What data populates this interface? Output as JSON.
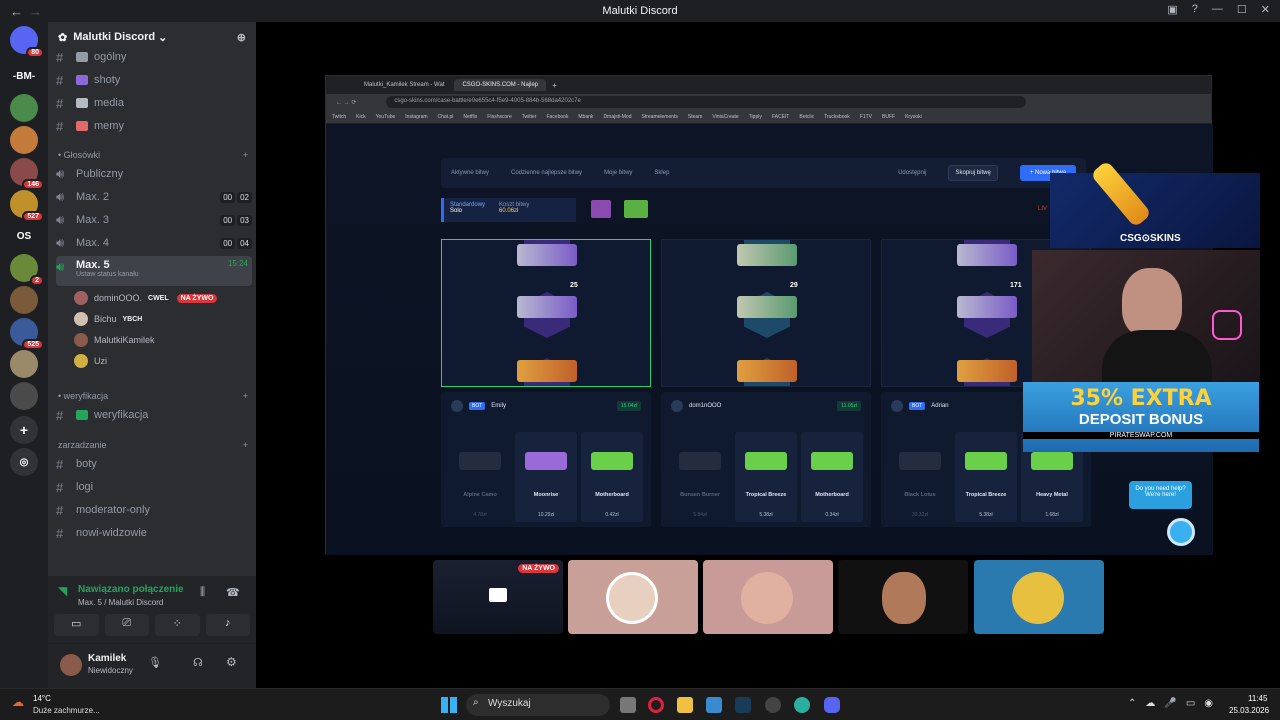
{
  "window": {
    "title": "Malutki Discord",
    "back": "←",
    "forward": "→"
  },
  "guilds": [
    {
      "label": "",
      "badge": "80",
      "color": "#5865f2"
    },
    {
      "label": "-BM-",
      "badge": "",
      "color": "#1e1f22"
    },
    {
      "label": "",
      "badge": "",
      "color": "#4a8a4a"
    },
    {
      "label": "",
      "badge": "",
      "color": "#c47a3a"
    },
    {
      "label": "",
      "badge": "146",
      "color": "#8a4a4a"
    },
    {
      "label": "",
      "badge": "527",
      "color": "#c0902a"
    },
    {
      "label": "OS",
      "badge": "",
      "color": "#1e1f22"
    },
    {
      "label": "",
      "badge": "2",
      "color": "#6a8a3a"
    },
    {
      "label": "",
      "badge": "",
      "color": "#7a5a3a"
    },
    {
      "label": "",
      "badge": "525",
      "color": "#3a5a9a"
    },
    {
      "label": "",
      "badge": "",
      "color": "#9a8a6a"
    },
    {
      "label": "",
      "badge": "",
      "color": "#4a4a4a"
    }
  ],
  "server": {
    "name": "Malutki Discord"
  },
  "text_channels_top": [
    {
      "name": "ogólny",
      "color": "#949ba4"
    },
    {
      "name": "shoty",
      "color": "#8a6ad8"
    },
    {
      "name": "media",
      "color": "#b5bac1"
    },
    {
      "name": "memy",
      "color": "#e06a6a"
    }
  ],
  "voice_category": "• Głosówki",
  "voice_channels": [
    {
      "name": "Publiczny",
      "a": "",
      "b": ""
    },
    {
      "name": "Max. 2",
      "a": "00",
      "b": "02"
    },
    {
      "name": "Max. 3",
      "a": "00",
      "b": "03"
    },
    {
      "name": "Max. 4",
      "a": "00",
      "b": "04"
    }
  ],
  "active_voice": {
    "name": "Max. 5",
    "time": "15:24",
    "status": "Ustaw status kanału"
  },
  "voice_users": [
    {
      "name": "dominOOO.",
      "tag": "CWEL",
      "live": "NA ŻYWO",
      "color": "#a06060"
    },
    {
      "name": "Bichu",
      "tag": "YBCH",
      "live": "",
      "color": "#d0c0b0"
    },
    {
      "name": "MalutkiKamilek",
      "tag": "",
      "live": "",
      "color": "#8a5a4a"
    },
    {
      "name": "Uzi",
      "tag": "",
      "live": "",
      "color": "#d0b040"
    }
  ],
  "verify_category": "• weryfikacja",
  "verify_channel": "weryfikacja",
  "admin_category": "zarzadzanie",
  "admin_channels": [
    "boty",
    "logi",
    "moderator-only",
    "nowi-widzowie"
  ],
  "voice_panel": {
    "status": "Nawiązano połączenie",
    "where": "Max. 5 / Malutki Discord"
  },
  "user_panel": {
    "name": "Kamilek",
    "status": "Niewidoczny"
  },
  "browser": {
    "tabs": [
      "Malutki_Kamilek Stream - Wat",
      "CSGO-SKINS.COM - Najlep"
    ],
    "url": "csgo-skins.com/case-battle/e0e655c4-f5e9-4005-884b-568da4202c7e",
    "bookmarks": [
      "Twitch",
      "Kick",
      "YouTube",
      "Instagram",
      "Chat.pl",
      "Netflix",
      "Flashscore",
      "Twitter",
      "Facebook",
      "Mbank",
      "Dmajsti-Mod",
      "Streamelements",
      "Steam",
      "VintaCreate",
      "Tipply",
      "FACEIT",
      "Betclic",
      "Trucksbook",
      "F1TV",
      "BUFF",
      "Kryooki"
    ]
  },
  "site": {
    "nav": [
      "Aktywne bitwy",
      "Codzienne najlepsze bitwy",
      "Moje bitwy",
      "Sklep"
    ],
    "share": "Udostępnij",
    "copy": "Skopiuj bitwę",
    "new": "+ Nowa bitwa",
    "mode": "Standardowy",
    "mode_sub": "Solo",
    "cost_label": "Koszt bitwy",
    "cost": "60.06zł",
    "live": "LIV",
    "multipliers": [
      "25",
      "29",
      "171"
    ],
    "players": [
      {
        "name": "Emily",
        "bot": "BOT",
        "amount": "15.04zł",
        "cards": [
          {
            "name": "Alpine Camo",
            "price": "4.78zł",
            "dim": true
          },
          {
            "name": "Moonrise",
            "price": "10.29zł",
            "dim": false
          },
          {
            "name": "Motherboard",
            "price": "0.42zł",
            "dim": false
          }
        ]
      },
      {
        "name": "dom1nOOO",
        "bot": "",
        "amount": "11.05zł",
        "cards": [
          {
            "name": "Bunsen Burner",
            "price": "5.84zł",
            "dim": true
          },
          {
            "name": "Tropical Breeze",
            "price": "5.38zł",
            "dim": false
          },
          {
            "name": "Motherboard",
            "price": "0.34zł",
            "dim": false
          }
        ]
      },
      {
        "name": "Adrian",
        "bot": "BOT",
        "amount": "",
        "cards": [
          {
            "name": "Black Lotus",
            "price": "33.32zł",
            "dim": true
          },
          {
            "name": "Tropical Breeze",
            "price": "5.38zł",
            "dim": false
          },
          {
            "name": "Heavy Metal",
            "price": "1.68zł",
            "dim": false
          }
        ]
      }
    ],
    "help": "Do you need help? We're here!"
  },
  "overlay": {
    "logo": "CSG⊙SKINS",
    "promo1": "35% EXTRA",
    "promo2": "DEPOSIT BONUS",
    "promo_site": "PIRATESWAP.COM"
  },
  "stream_tiles": [
    {
      "live": "NA ŻYWO"
    }
  ],
  "taskbar": {
    "weather_temp": "14°C",
    "weather_desc": "Duże zachmurze...",
    "search": "Wyszukaj",
    "time": "11:45",
    "date": "25.03.2026"
  }
}
